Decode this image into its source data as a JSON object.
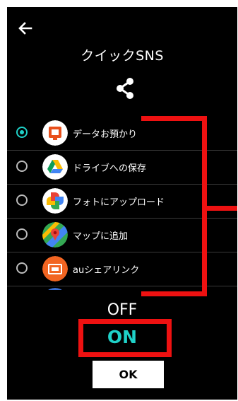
{
  "header": {
    "title": "クイックSNS",
    "back_icon": "arrow-left-icon",
    "share_icon": "share-icon"
  },
  "list": {
    "items": [
      {
        "label": "データお預かり",
        "icon": "data-backup-icon",
        "selected": true
      },
      {
        "label": "ドライブへの保存",
        "icon": "google-drive-icon",
        "selected": false
      },
      {
        "label": "フォトにアップロード",
        "icon": "google-photos-icon",
        "selected": false
      },
      {
        "label": "マップに追加",
        "icon": "google-maps-icon",
        "selected": false
      },
      {
        "label": "auシェアリンク",
        "icon": "au-share-link-icon",
        "selected": false
      }
    ]
  },
  "picker": {
    "off_label": "OFF",
    "on_label": "ON"
  },
  "ok_label": "OK",
  "colors": {
    "accent": "#1fd1c8",
    "highlight": "#ee1111",
    "background": "#000000"
  }
}
